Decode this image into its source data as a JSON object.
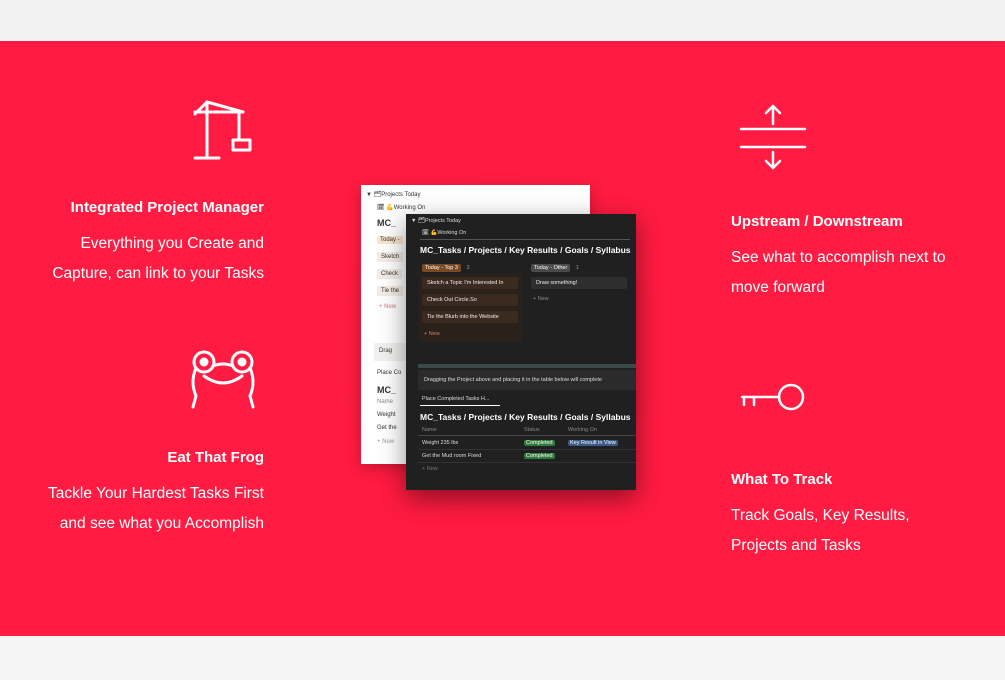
{
  "features": {
    "left": [
      {
        "icon": "crane-icon",
        "title": "Integrated Project Manager",
        "desc_lines": [
          "Everything you Create and",
          "Capture, can link to your Tasks"
        ]
      },
      {
        "icon": "frog-icon",
        "title": "Eat That Frog",
        "desc_lines": [
          "Tackle Your Hardest Tasks First",
          "and see what you Accomplish"
        ]
      }
    ],
    "right": [
      {
        "icon": "upstream-downstream-icon",
        "title": "Upstream / Downstream",
        "desc_lines": [
          "See what to accomplish next to",
          "move forward"
        ]
      },
      {
        "icon": "key-icon",
        "title": "What To Track",
        "desc_lines": [
          "Track Goals, Key Results,",
          "Projects and Tasks"
        ]
      }
    ]
  },
  "screenshot_back": {
    "toggle": "▼ 🗂Projects Today",
    "view": "🗓 💪Working On",
    "heading": "MC_",
    "today_label": "Today -",
    "items": [
      "Sketch",
      "Check",
      "Tie the"
    ],
    "new": "+ New",
    "drag_label": "Drag",
    "place_label": "Place Co",
    "heading2": "MC_",
    "name_col": "Name",
    "rows": [
      "Weight",
      "Get the"
    ],
    "new2": "+ New"
  },
  "screenshot_front": {
    "toggle": "▼ 🗂Projects Today",
    "view": "🗓 💪Working On",
    "heading": "MC_Tasks / Projects / Key Results / Goals / Syllabus",
    "col1_label": "Today - Top 3",
    "col1_count": "3",
    "col2_label": "Today - Other",
    "col2_count": "1",
    "col1_items": [
      "Sketch a Topic I'm Interested In",
      "Check Out Circle.So",
      "Tie the Blurb into the Website"
    ],
    "col2_items": [
      "Draw something!"
    ],
    "new": "+ New",
    "callout": "Dragging the Project above and placing it in the table below will complete",
    "view2": "Place Completed Tasks H...",
    "heading2": "MC_Tasks / Projects / Key Results / Goals / Syllabus",
    "table_cols": [
      "Name",
      "Status",
      "Working On"
    ],
    "rows": [
      {
        "name": "Weight 235 lbs",
        "status": "Completed",
        "working": "Key Result in View"
      },
      {
        "name": "Get the Mud room Fixed",
        "status": "Completed",
        "working": ""
      }
    ],
    "new2": "+ New"
  },
  "colors": {
    "accent": "#ff1b41",
    "text": "#ffffff"
  }
}
